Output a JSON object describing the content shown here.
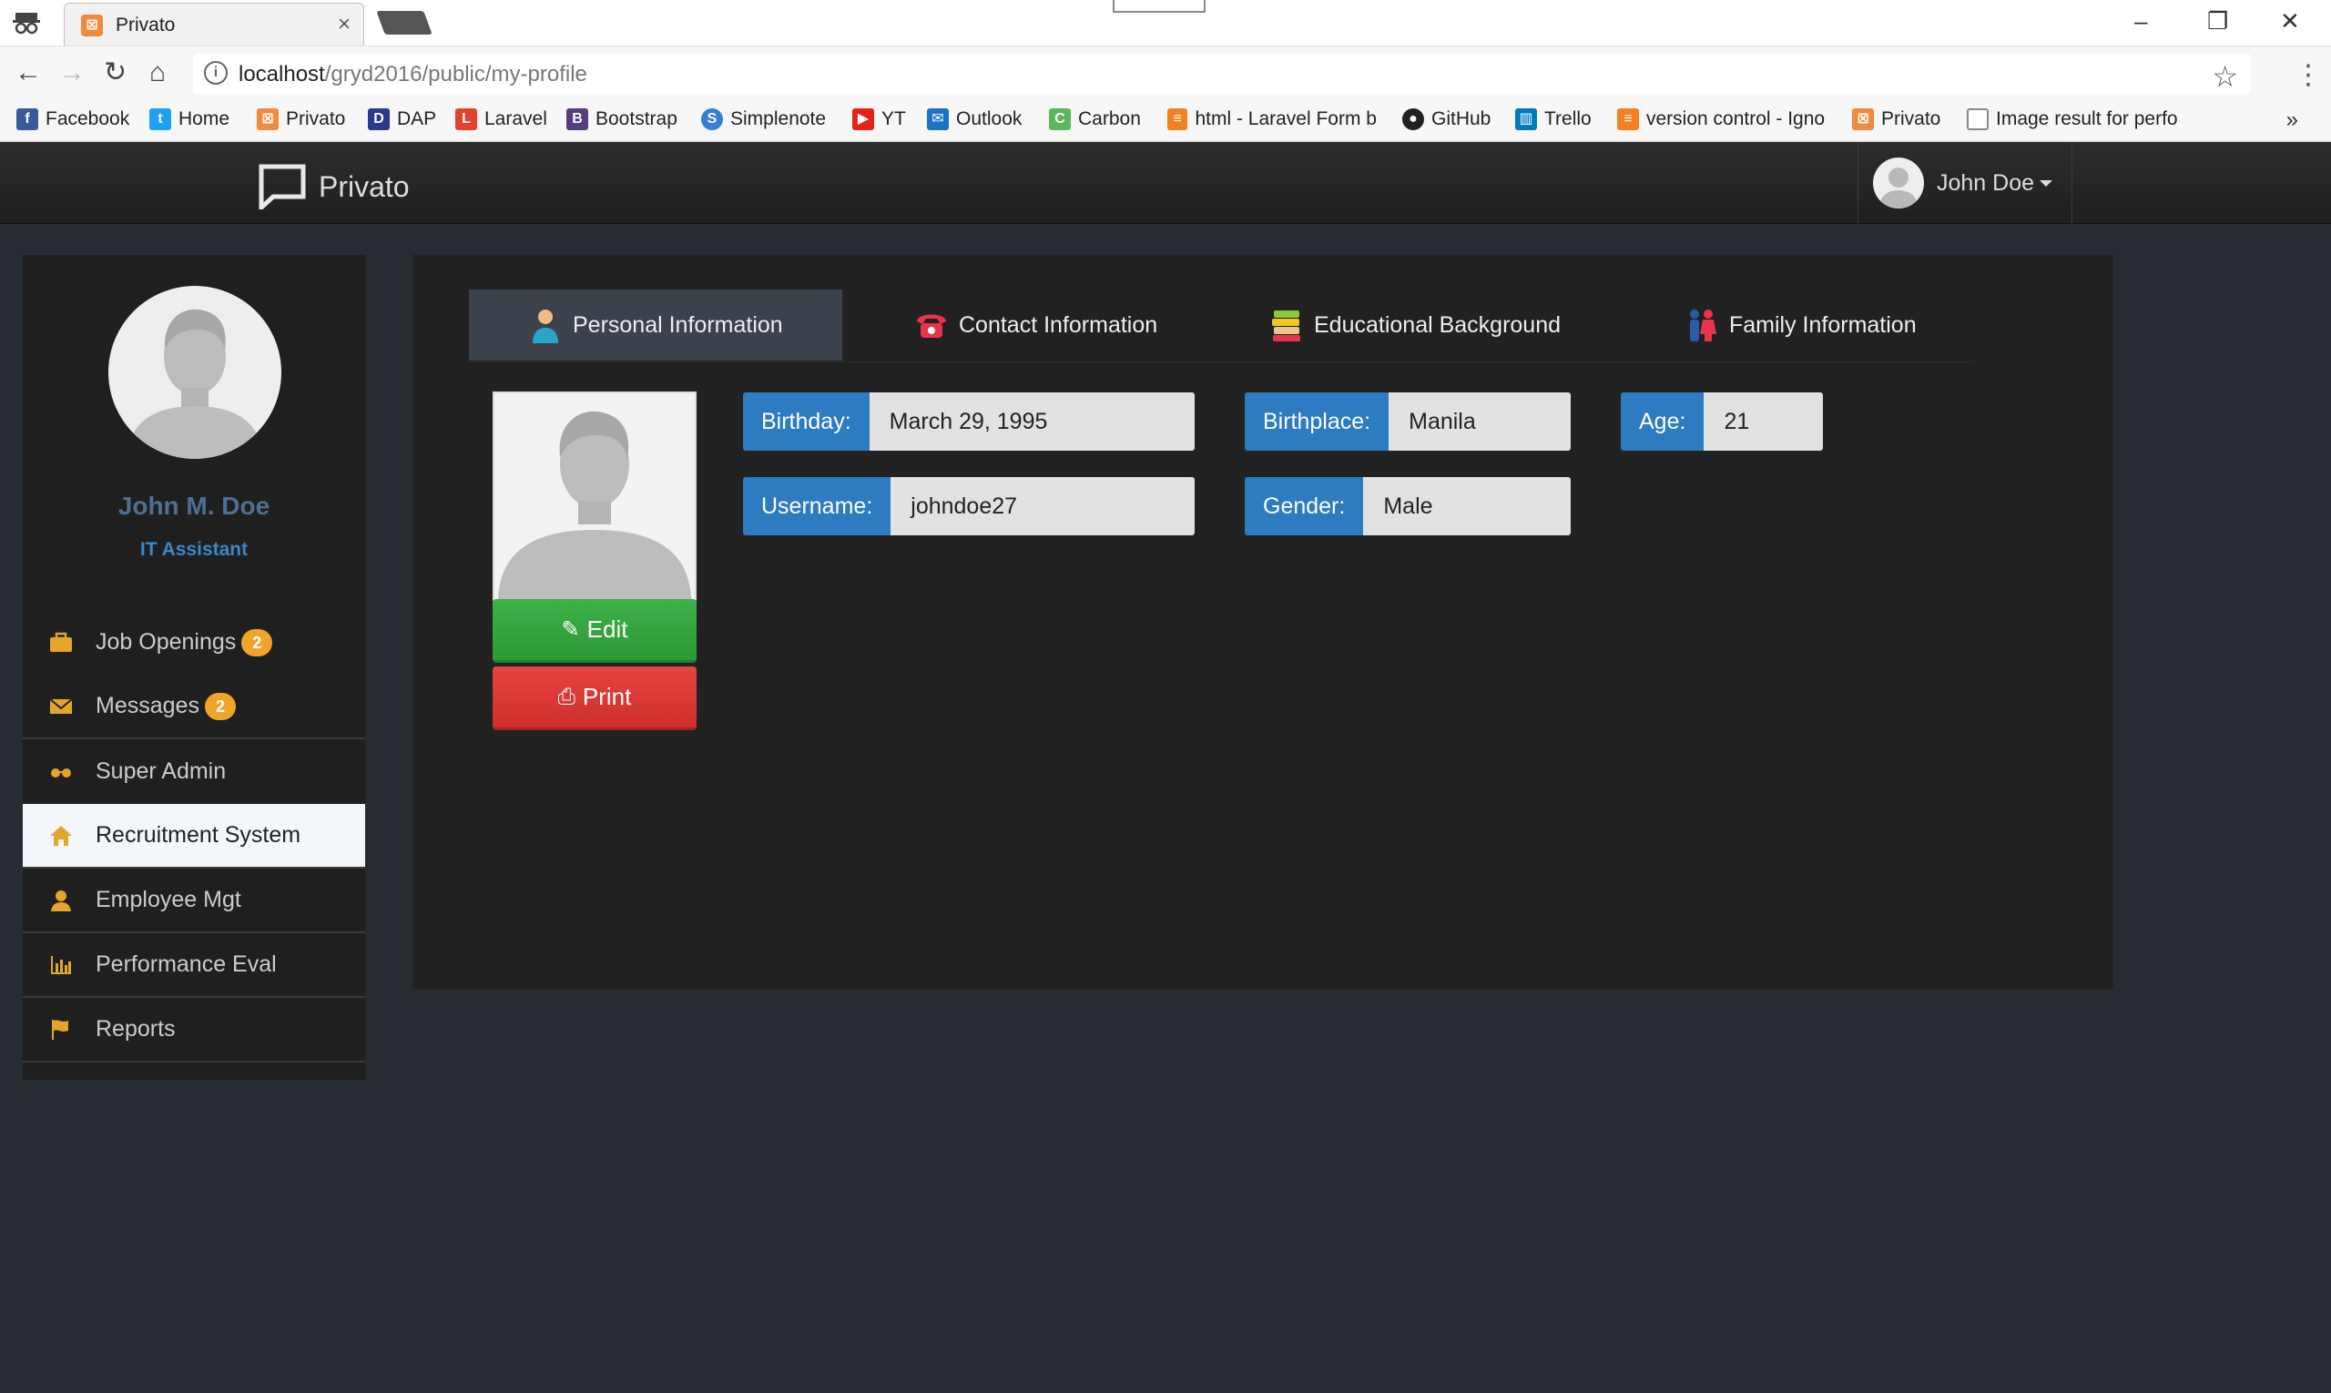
{
  "browser": {
    "tab_title": "Privato",
    "url_host": "localhost",
    "url_path": "/gryd2016/public/my-profile",
    "bookmarks": [
      {
        "label": "Facebook",
        "color": "#3b5998"
      },
      {
        "label": "Home",
        "color": "#1da1f2"
      },
      {
        "label": "Privato",
        "color": "#f08a3c"
      },
      {
        "label": "DAP",
        "color": "#2b3a8c"
      },
      {
        "label": "Laravel",
        "color": "#e3422f"
      },
      {
        "label": "Bootstrap",
        "color": "#563d7c"
      },
      {
        "label": "Simplenote",
        "color": "#3a7bd5"
      },
      {
        "label": "YT",
        "color": "#e62117"
      },
      {
        "label": "Outlook",
        "color": "#1a73c7"
      },
      {
        "label": "Carbon",
        "color": "#5cb85c"
      },
      {
        "label": "html - Laravel Form b",
        "color": "#f48024"
      },
      {
        "label": "GitHub",
        "color": "#222222"
      },
      {
        "label": "Trello",
        "color": "#0079bf"
      },
      {
        "label": "version control - Igno",
        "color": "#f48024"
      },
      {
        "label": "Privato",
        "color": "#f08a3c"
      },
      {
        "label": "Image result for perfo",
        "color": "#888888"
      }
    ],
    "more": "»"
  },
  "app": {
    "brand": "Privato",
    "user_menu_name": "John Doe"
  },
  "sidebar": {
    "full_name": "John M. Doe",
    "position": "IT Assistant",
    "items": [
      {
        "label": "Job Openings",
        "icon": "briefcase-icon",
        "badge": "2"
      },
      {
        "label": "Messages",
        "icon": "envelope-icon",
        "badge": "2"
      },
      {
        "label": "Super Admin",
        "icon": "glasses-icon"
      },
      {
        "label": "Recruitment System",
        "icon": "home-icon",
        "active": true
      },
      {
        "label": "Employee Mgt",
        "icon": "user-icon"
      },
      {
        "label": "Performance Eval",
        "icon": "bar-chart-icon"
      },
      {
        "label": "Reports",
        "icon": "flag-icon"
      }
    ]
  },
  "tabs": [
    {
      "label": "Personal Information",
      "icon": "person-icon",
      "active": true
    },
    {
      "label": "Contact Information",
      "icon": "telephone-icon"
    },
    {
      "label": "Educational Background",
      "icon": "books-icon"
    },
    {
      "label": "Family Information",
      "icon": "family-icon"
    }
  ],
  "actions": {
    "edit": "Edit",
    "print": "Print"
  },
  "fields": {
    "birthday_label": "Birthday:",
    "birthday": "March 29, 1995",
    "birthplace_label": "Birthplace:",
    "birthplace": "Manila",
    "age_label": "Age:",
    "age": "21",
    "username_label": "Username:",
    "username": "johndoe27",
    "gender_label": "Gender:",
    "gender": "Male"
  },
  "colors": {
    "accent": "#2d7bc0",
    "edit": "#3fb04a",
    "print": "#e5433f",
    "badge": "#f0a429"
  }
}
